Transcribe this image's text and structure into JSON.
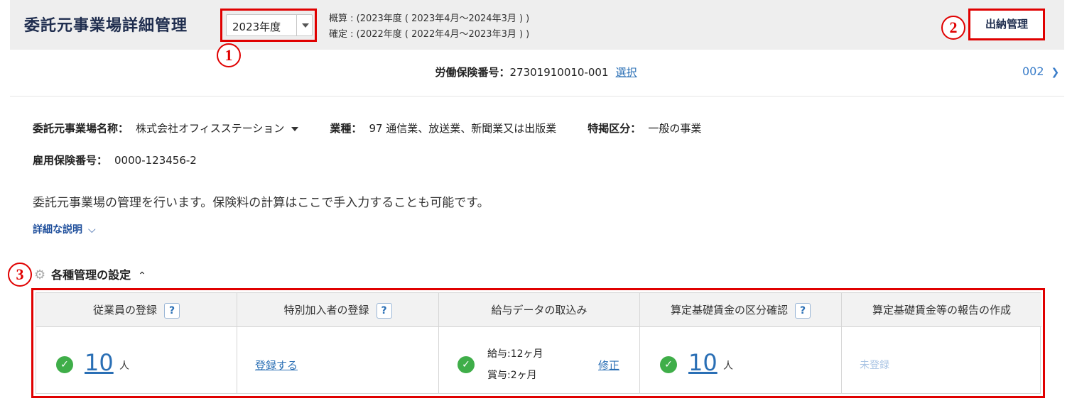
{
  "header": {
    "title": "委託元事業場詳細管理",
    "year_value": "2023年度",
    "period_estimate": "概算 : (2023年度 ( 2023年4月～2024年3月 ) )",
    "period_confirm": "確定 : (2022年度 ( 2022年4月～2023年3月 ) )",
    "suinou_label": "出納管理"
  },
  "markers": {
    "m1": "1",
    "m2": "2",
    "m3": "3"
  },
  "insurance": {
    "label": "労働保険番号：",
    "number": "27301910010-001",
    "select_link": "選択",
    "next_label": "002",
    "next_icon": "chevron-right-icon"
  },
  "info": {
    "office_name_label": "委託元事業場名称：",
    "office_name_value": "株式会社オフィスステーション",
    "industry_label": "業種：",
    "industry_value": "97  通信業、放送業、新聞業又は出版業",
    "special_label": "特掲区分：",
    "special_value": "一般の事業",
    "employment_label": "雇用保険番号：",
    "employment_value": "0000-123456-2"
  },
  "description": "委託元事業場の管理を行います。保険料の計算はここで手入力することも可能です。",
  "detail_link": "詳細な説明",
  "settings": {
    "title": "各種管理の設定",
    "columns": [
      {
        "label": "従業員の登録",
        "has_help": true,
        "count": "10",
        "unit": "人"
      },
      {
        "label": "特別加入者の登録",
        "has_help": true,
        "action": "登録する"
      },
      {
        "label": "給与データの取込み",
        "has_help": false,
        "salary": "給与:12ヶ月",
        "bonus": "賞与:2ヶ月",
        "action": "修正"
      },
      {
        "label": "算定基礎賃金の区分確認",
        "has_help": true,
        "count": "10",
        "unit": "人"
      },
      {
        "label": "算定基礎賃金等の報告の作成",
        "has_help": false,
        "status": "未登録"
      }
    ],
    "help_glyph": "?"
  },
  "colors": {
    "accent": "#2a6fb5",
    "highlight": "#e00000",
    "ok": "#3fae49",
    "title": "#1f2d4e"
  }
}
